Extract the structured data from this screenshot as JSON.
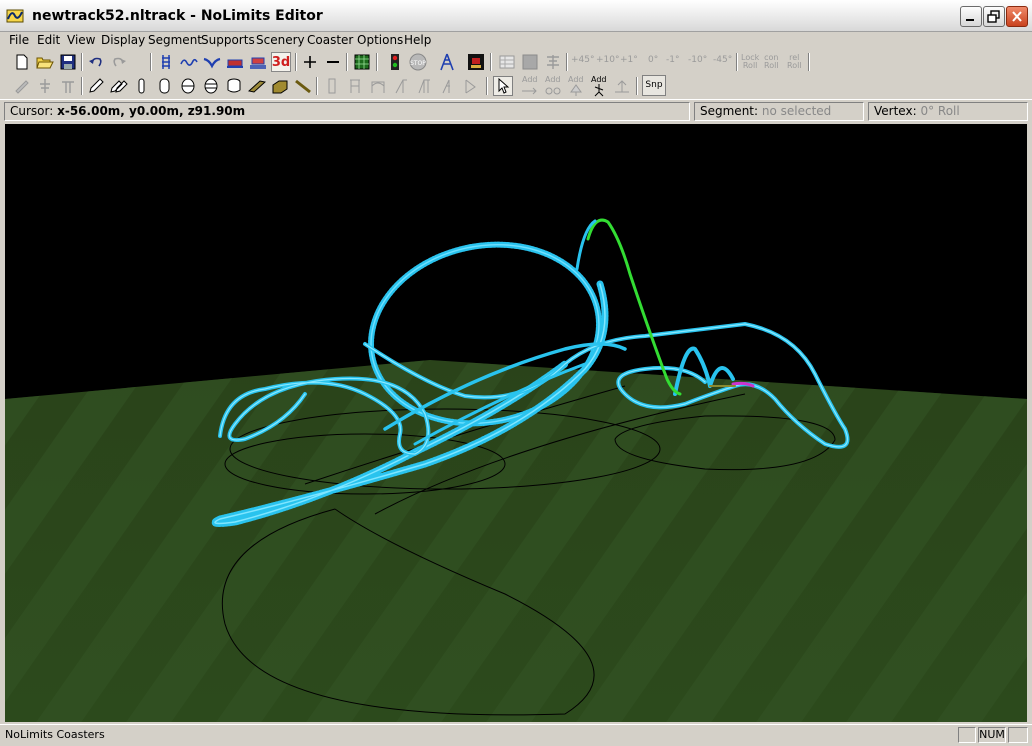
{
  "window": {
    "title": "newtrack52.nltrack - NoLimits Editor",
    "icon": "coaster-app-icon",
    "controls": [
      "minimize-icon",
      "restore-icon",
      "close-icon"
    ]
  },
  "menu": {
    "items": [
      "File",
      "Edit",
      "View",
      "Display",
      "Segment",
      "Supports",
      "Scenery",
      "Coaster",
      "Options",
      "Help"
    ]
  },
  "toolbar1": {
    "icons": [
      "new-icon",
      "open-icon",
      "save-icon",
      "undo-icon",
      "redo-icon",
      "track-icon",
      "wave-icon",
      "valley-icon",
      "station-icon",
      "transfer-icon",
      "3d-icon",
      "add-vertex-icon",
      "remove-vertex-icon",
      "grid-icon",
      "traffic-light-icon",
      "stop-icon",
      "support-tower-icon",
      "film-icon",
      "table-icon",
      "gray-square-icon",
      "align-icon"
    ],
    "label_3d": "3d",
    "roll_buttons": [
      "+45°",
      "+10°",
      "+1°",
      "0°",
      "-1°",
      "-10°",
      "-45°"
    ],
    "lock_roll": "Lock\nRoll",
    "con_roll": "con\nRoll",
    "rel_roll": "rel\nRoll"
  },
  "toolbar2": {
    "icons": [
      "pen-disabled-icon",
      "support-disabled-icon",
      "support2-disabled-icon",
      "pencil-icon",
      "pencil-double-icon",
      "tube-thin-icon",
      "tube-icon",
      "tube-ring-icon",
      "tube-ring2-icon",
      "cylinder-icon",
      "plank-icon",
      "block-icon",
      "rail-icon",
      "column-icon",
      "column2-icon",
      "arch-icon",
      "slant-icon",
      "slant2-icon",
      "slant3-icon",
      "slant4-icon",
      "pointer-icon",
      "add-joint-icon",
      "add-link-icon",
      "add-tree-icon",
      "add-person-icon",
      "add-base-icon"
    ],
    "add_labels": [
      "Add",
      "Add",
      "Add",
      "Add"
    ],
    "snap_label": "Snp"
  },
  "status": {
    "cursor_label": "Cursor:",
    "cursor_value": "x-56.00m, y0.00m, z91.90m",
    "segment_label": "Segment:",
    "segment_value": "no selected",
    "vertex_label": "Vertex:",
    "vertex_value": "0° Roll"
  },
  "viewport": {
    "sky_color": "#000000",
    "ground_color": "#2e4a1c",
    "track_color": "#29c3ee",
    "selected_color": "#33dd33",
    "accent_color": "#cc33cc"
  },
  "bottom": {
    "app_label": "NoLimits Coasters",
    "num_label": "NUM"
  }
}
